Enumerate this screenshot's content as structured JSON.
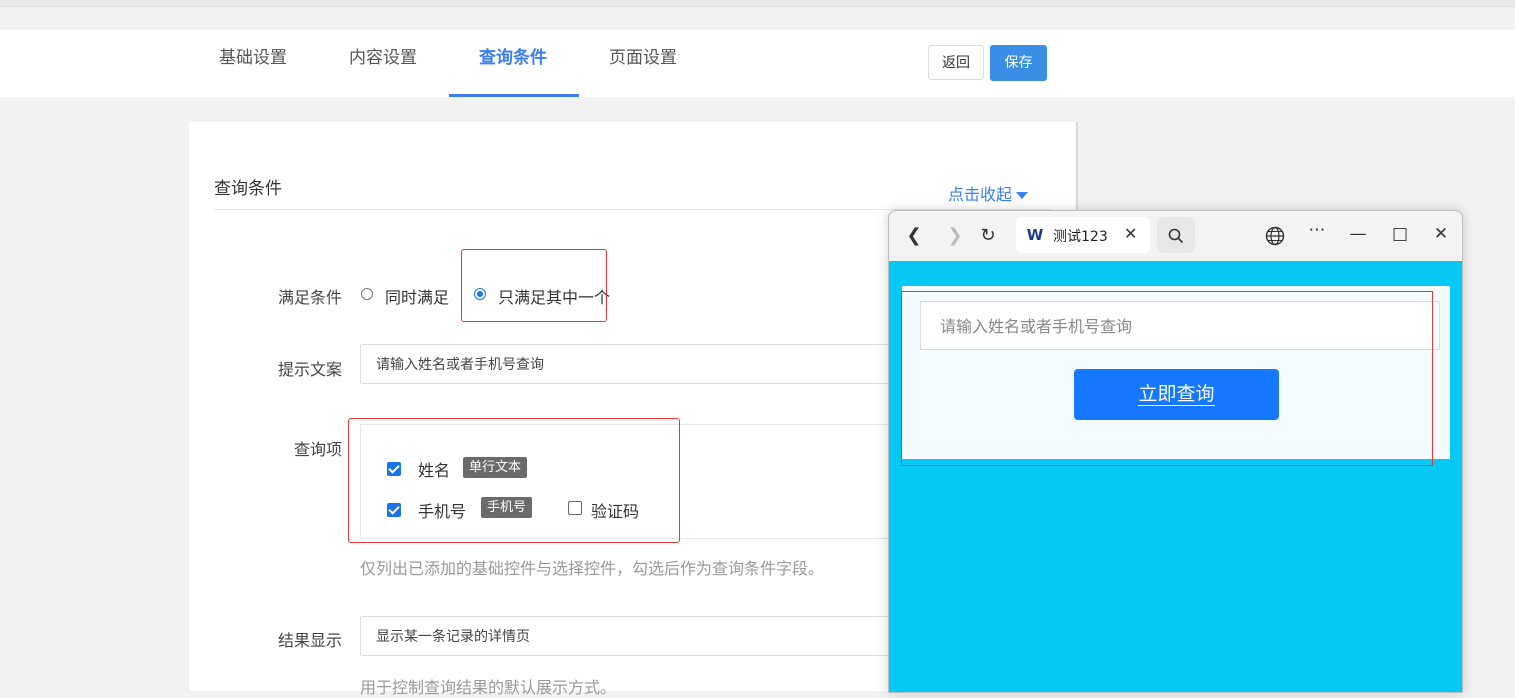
{
  "tabs": [
    "基础设置",
    "内容设置",
    "查询条件",
    "页面设置"
  ],
  "active_tab": "查询条件",
  "actions": {
    "back": "返回",
    "save": "保存"
  },
  "section": {
    "title": "查询条件",
    "collapse": "点击收起"
  },
  "condition": {
    "label": "满足条件",
    "options": [
      "同时满足",
      "只满足其中一个"
    ],
    "selected": "只满足其中一个"
  },
  "prompt": {
    "label": "提示文案",
    "value": "请输入姓名或者手机号查询"
  },
  "query_items": {
    "label": "查询项",
    "items": [
      {
        "name": "姓名",
        "badge": "单行文本",
        "checked": true
      },
      {
        "name": "手机号",
        "badge": "手机号",
        "checked": true
      },
      {
        "name": "验证码",
        "badge": "",
        "checked": false
      }
    ],
    "hint": "仅列出已添加的基础控件与选择控件，勾选后作为查询条件字段。"
  },
  "result": {
    "label": "结果显示",
    "value": "显示某一条记录的详情页",
    "hint": "用于控制查询结果的默认展示方式。"
  },
  "preview": {
    "tab_title": "测试123",
    "tab_logo": "W",
    "input_placeholder": "请输入姓名或者手机号查询",
    "button": "立即查询",
    "background": "#06c8f5",
    "button_color": "#1677ff"
  },
  "colors": {
    "accent": "#3a7ef2",
    "highlight": "#e53935"
  }
}
